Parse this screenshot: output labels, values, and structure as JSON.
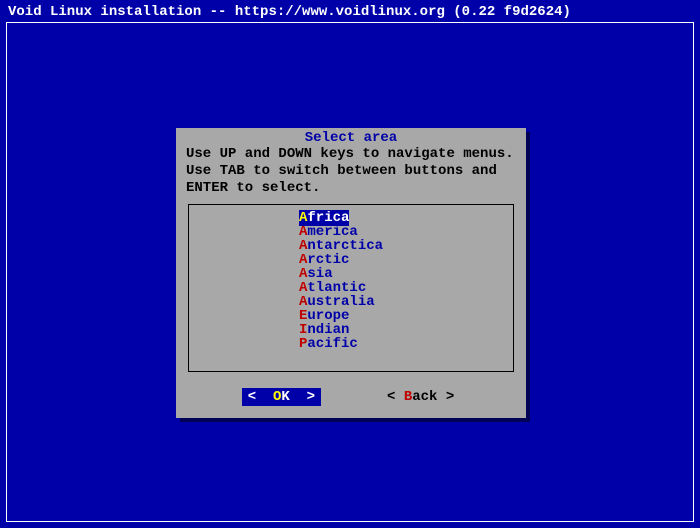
{
  "header": {
    "title": "Void Linux installation -- https://www.voidlinux.org (0.22 f9d2624)"
  },
  "dialog": {
    "title": "Select area",
    "instructions": "Use UP and DOWN keys to navigate menus. Use TAB to switch between buttons and ENTER to select.",
    "items": [
      {
        "hotkey": "A",
        "rest": "frica",
        "selected": true
      },
      {
        "hotkey": "A",
        "rest": "merica",
        "selected": false
      },
      {
        "hotkey": "A",
        "rest": "ntarctica",
        "selected": false
      },
      {
        "hotkey": "A",
        "rest": "rctic",
        "selected": false
      },
      {
        "hotkey": "A",
        "rest": "sia",
        "selected": false
      },
      {
        "hotkey": "A",
        "rest": "tlantic",
        "selected": false
      },
      {
        "hotkey": "A",
        "rest": "ustralia",
        "selected": false
      },
      {
        "hotkey": "E",
        "rest": "urope",
        "selected": false
      },
      {
        "hotkey": "I",
        "rest": "ndian",
        "selected": false
      },
      {
        "hotkey": "P",
        "rest": "acific",
        "selected": false
      }
    ],
    "buttons": {
      "ok": {
        "hotkey": "O",
        "rest": "K"
      },
      "back": {
        "hotkey": "B",
        "rest": "ack"
      }
    }
  }
}
